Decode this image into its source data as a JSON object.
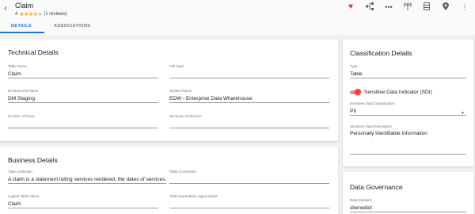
{
  "header": {
    "title": "Claim",
    "rating_value": "4",
    "rating_stars": 4,
    "rating_max": 5,
    "reviews": "(1 reviews)",
    "tabs": [
      {
        "label": "DETAILS",
        "active": true
      },
      {
        "label": "ASSOCIATIONS",
        "active": false
      }
    ],
    "actions": [
      "heart-icon",
      "hierarchy-icon",
      "more-horizontal-icon",
      "lineage-icon",
      "database-icon",
      "location-pin-icon",
      "more-vertical-icon"
    ],
    "accent_color": "#1976d2",
    "heart_color": "#e91e63"
  },
  "technical": {
    "title": "Technical Details",
    "fields": [
      {
        "label": "Table Name",
        "value": "Claim"
      },
      {
        "label": "File Type",
        "value": ""
      },
      {
        "label": "Environment Name",
        "value": "DM Staging"
      },
      {
        "label": "System Name",
        "value": "EDW - Enterprise Data Wharehouse"
      },
      {
        "label": "Number of Rows",
        "value": ""
      },
      {
        "label": "Synonym Reference",
        "value": ""
      }
    ]
  },
  "business": {
    "title": "Business Details",
    "fields": [
      {
        "label": "Table Definition",
        "value": "A claim is a statement listing services rendered, the dates of services,"
      },
      {
        "label": "Table Comments",
        "value": ""
      },
      {
        "label": "Logical Table Name",
        "value": "Claim"
      },
      {
        "label": "Table Expanded Logical Name",
        "value": ""
      }
    ]
  },
  "classification": {
    "title": "Classification Details",
    "type_label": "Type",
    "type_value": "Table",
    "sdi_label": "Sensitive Data Indicator (SDI)",
    "sdi_on": true,
    "sdc_label": "Sensitive Data Classification",
    "sdc_value": "PII",
    "sdd_label": "Sensitive Data Description",
    "sdd_value": "Personally Identifiable Information",
    "toggle_color": "#f44336"
  },
  "governance": {
    "title": "Data Governance",
    "steward_label": "Data Steward",
    "steward_value": "sbenedict"
  }
}
